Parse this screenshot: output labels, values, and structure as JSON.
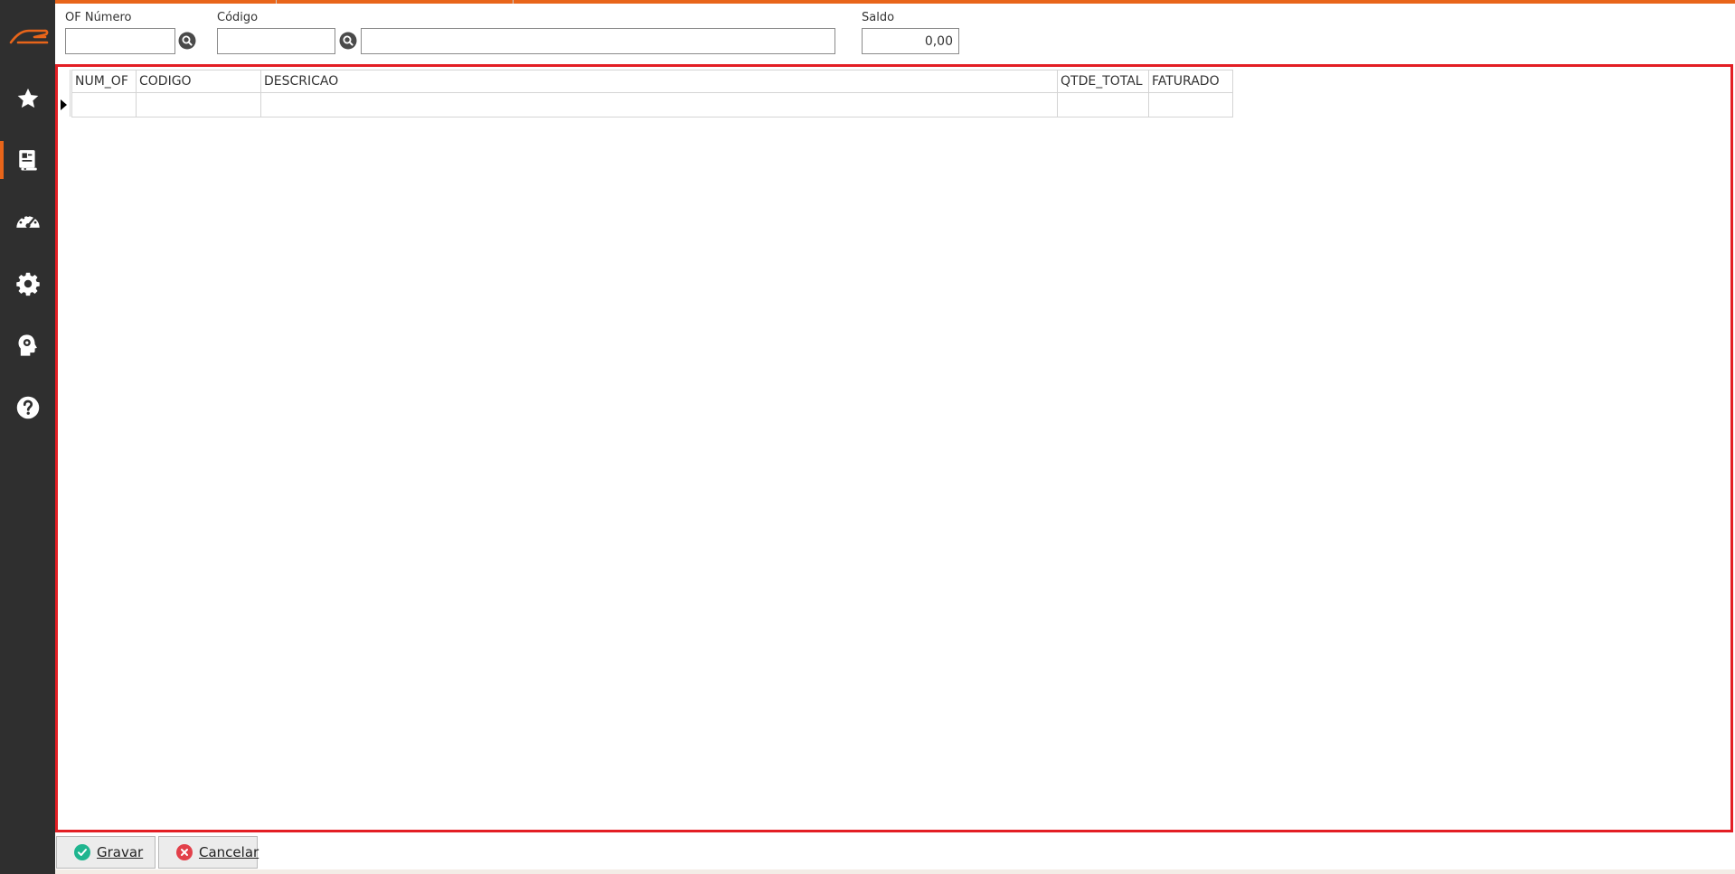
{
  "sidebar": {
    "logo": "ce-logo-icon",
    "items": [
      {
        "icon": "star-icon",
        "active": false
      },
      {
        "icon": "document-icon",
        "active": true
      },
      {
        "icon": "speedometer-icon",
        "active": false
      },
      {
        "icon": "gear-icon",
        "active": false
      },
      {
        "icon": "head-gear-icon",
        "active": false
      },
      {
        "icon": "help-icon",
        "active": false
      }
    ]
  },
  "filters": {
    "of_numero": {
      "label": "OF Número",
      "value": ""
    },
    "codigo": {
      "label": "Código",
      "value": ""
    },
    "descricao": {
      "value": ""
    },
    "saldo": {
      "label": "Saldo",
      "value": "0,00"
    }
  },
  "grid": {
    "columns": [
      "NUM_OF",
      "CODIGO",
      "DESCRICAO",
      "QTDE_TOTAL",
      "FATURADO"
    ],
    "rows": [
      [
        "",
        "",
        "",
        "",
        ""
      ]
    ]
  },
  "buttons": {
    "gravar": "Gravar",
    "cancelar": "Cancelar"
  },
  "colors": {
    "accent": "#e8651a",
    "highlight_border": "#e31e24",
    "sidebar_bg": "#2f2f2f",
    "gravar_icon": "#1fb58f",
    "cancelar_icon": "#e2404a"
  }
}
